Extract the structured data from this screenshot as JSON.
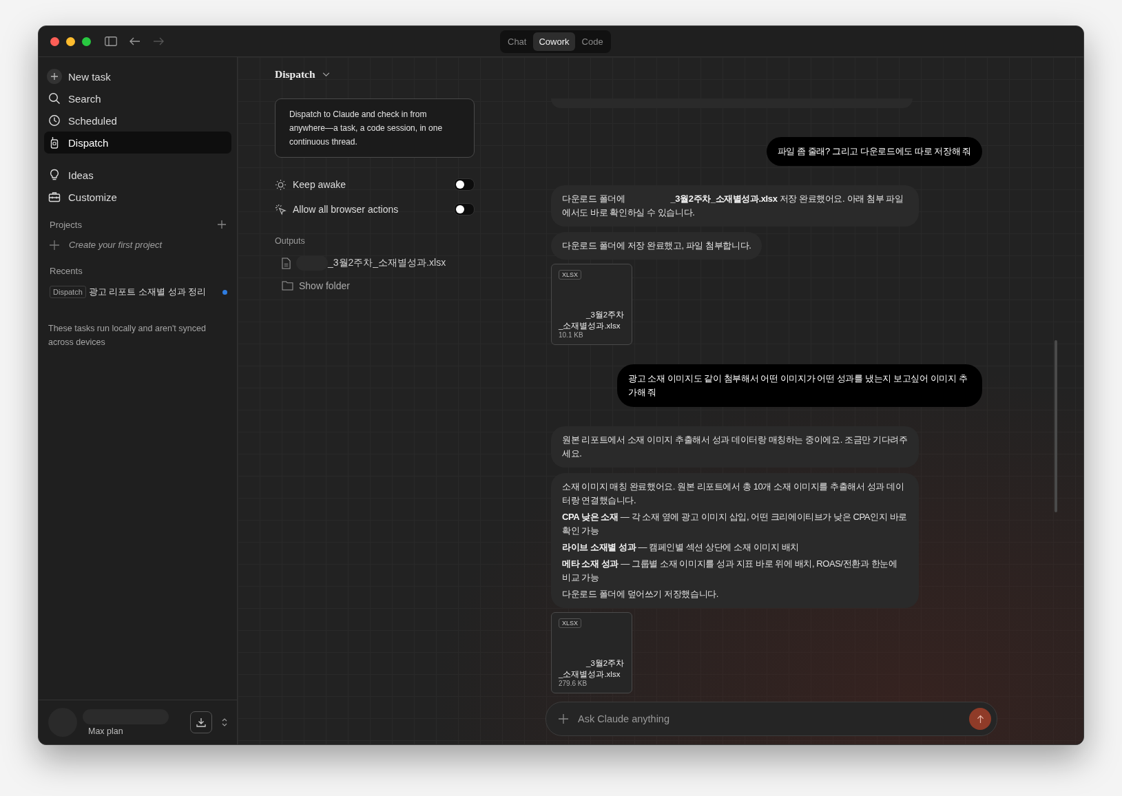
{
  "window": {
    "tabs": [
      {
        "label": "Chat",
        "selected": false
      },
      {
        "label": "Cowork",
        "selected": true
      },
      {
        "label": "Code",
        "selected": false
      }
    ]
  },
  "sidebar": {
    "nav": [
      {
        "label": "New task",
        "selected": false
      },
      {
        "label": "Search",
        "selected": false
      },
      {
        "label": "Scheduled",
        "selected": false
      },
      {
        "label": "Dispatch",
        "selected": true
      }
    ],
    "nav2": [
      {
        "label": "Ideas",
        "selected": false
      },
      {
        "label": "Customize",
        "selected": false
      }
    ],
    "projects": {
      "heading": "Projects",
      "create": "Create your first project"
    },
    "recents": {
      "heading": "Recents",
      "items": [
        {
          "tag": "Dispatch",
          "title": "광고 리포트 소재별 성과 정리",
          "unread": true
        }
      ]
    },
    "note": "These tasks run locally and aren't synced across devices",
    "account": {
      "plan": "Max plan"
    }
  },
  "panel": {
    "title": "Dispatch",
    "description": "Dispatch to Claude and check in from anywhere—a task, a code session, in one continuous thread.",
    "settings": [
      {
        "label": "Keep awake",
        "on": false
      },
      {
        "label": "Allow all browser actions",
        "on": false
      }
    ],
    "outputs_heading": "Outputs",
    "outputs": [
      {
        "name": "_3월2주차_소재별성과.xlsx"
      }
    ],
    "show_folder": "Show folder"
  },
  "chat": {
    "messages": [
      {
        "from_user": true,
        "kind": "text",
        "paragraphs": [
          "파일 좀 줄래? 그리고 다운로드에도 따로 저장해 줘"
        ]
      },
      {
        "from_user": false,
        "kind": "saved",
        "before": "다운로드 폴더에",
        "rest": "**_3월2주차_소재별성과.xlsx** 저장 완료했어요. 아래 첨부 파일에서도 바로 확인하실 수 있습니다."
      },
      {
        "from_user": false,
        "kind": "text",
        "paragraphs": [
          "다운로드 폴더에 저장 완료했고, 파일 첨부합니다."
        ]
      },
      {
        "from_user": false,
        "kind": "file",
        "type": "XLSX",
        "name_lines": [
          "_3월2주차",
          "_소재별성과.xlsx"
        ],
        "size": "10.1 KB"
      },
      {
        "from_user": true,
        "kind": "text",
        "paragraphs": [
          "광고 소재 이미지도 같이 첨부해서 어떤 이미지가 어떤 성과를 냈는지 보고싶어 이미지 추가해 줘"
        ]
      },
      {
        "from_user": false,
        "kind": "text",
        "paragraphs": [
          "원본 리포트에서 소재 이미지 추출해서 성과 데이터랑 매칭하는 중이에요. 조금만 기다려주세요."
        ]
      },
      {
        "from_user": false,
        "kind": "text",
        "paragraphs": [
          "소재 이미지 매칭 완료했어요. 원본 리포트에서 총 10개 소재 이미지를 추출해서 성과 데이터랑 연결했습니다.",
          "**CPA 낮은 소재** — 각 소재 옆에 광고 이미지 삽입, 어떤 크리에이티브가 낮은 CPA인지 바로 확인 가능",
          "**라이브 소재별 성과** — 캠페인별 섹션 상단에 소재 이미지 배치",
          "**메타 소재 성과** — 그룹별 소재 이미지를 성과 지표 바로 위에 배치, ROAS/전환과 한눈에 비교 가능",
          "다운로드 폴더에 덮어쓰기 저장했습니다."
        ]
      },
      {
        "from_user": false,
        "kind": "file",
        "type": "XLSX",
        "name_lines": [
          "_3월2주차",
          "_소재별성과.xlsx"
        ],
        "size": "279.6 KB"
      }
    ],
    "input": {
      "placeholder": "Ask Claude anything"
    }
  }
}
